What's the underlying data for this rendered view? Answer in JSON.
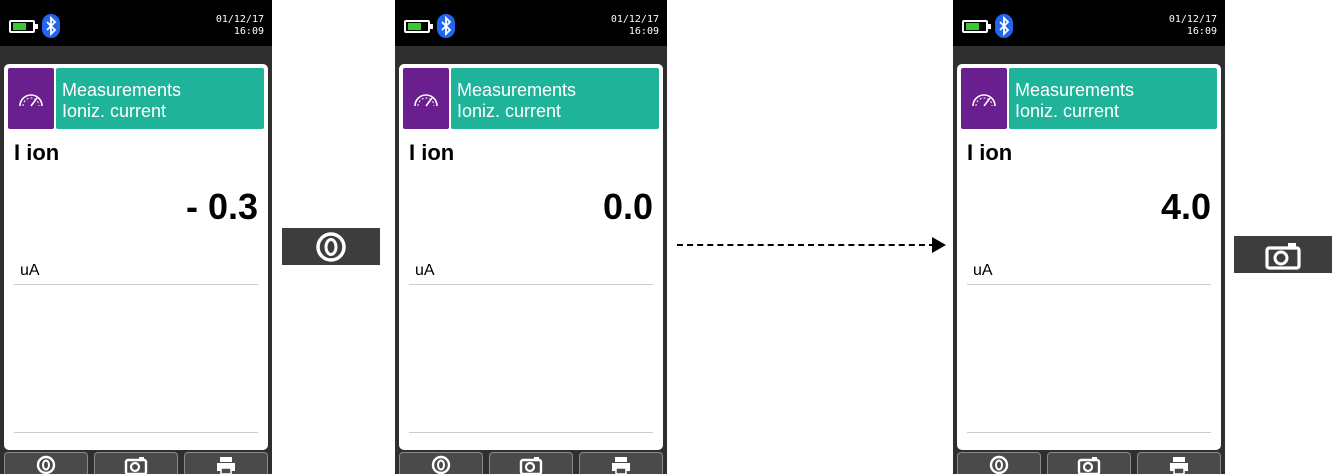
{
  "status": {
    "date": "01/12/17",
    "time": "16:09"
  },
  "menu": {
    "title": "Measurements",
    "subtitle": "Ioniz. current"
  },
  "screens": [
    {
      "parameter": "I ion",
      "value": "- 0.3",
      "unit": "uA"
    },
    {
      "parameter": "I ion",
      "value": "0.0",
      "unit": "uA"
    },
    {
      "parameter": "I ion",
      "value": "4.0",
      "unit": "uA"
    }
  ],
  "softkeys": [
    "zero-icon",
    "camera-icon",
    "printer-icon"
  ],
  "key_badges": [
    "zero-key-icon",
    "camera-key-icon"
  ],
  "colors": {
    "header_teal": "#1fb39a",
    "icon_purple": "#6a1f8f",
    "bluetooth_blue": "#2266ee",
    "battery_green": "#33cc33",
    "device_frame": "#2f2f2f"
  }
}
